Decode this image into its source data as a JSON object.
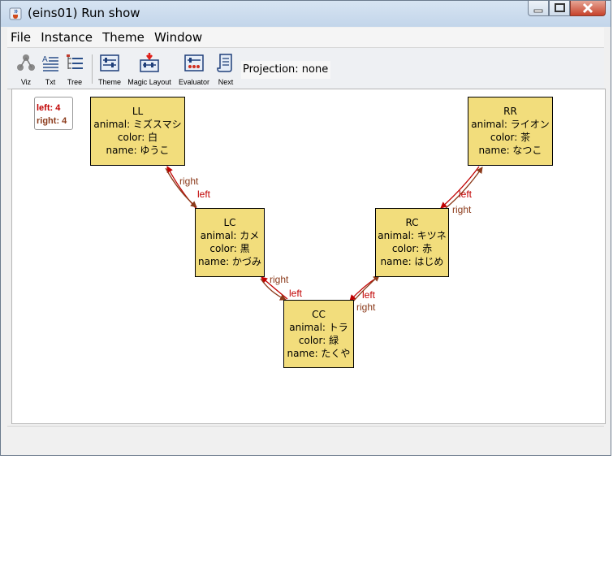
{
  "window": {
    "title": "(eins01) Run show"
  },
  "menu": [
    {
      "label": "File"
    },
    {
      "label": "Instance"
    },
    {
      "label": "Theme"
    },
    {
      "label": "Window"
    }
  ],
  "toolbar": {
    "viz": "Viz",
    "txt": "Txt",
    "tree": "Tree",
    "theme": "Theme",
    "magic_layout": "Magic Layout",
    "evaluator": "Evaluator",
    "next": "Next",
    "projection": "Projection: none"
  },
  "legend": {
    "left": "left: 4",
    "right": "right: 4"
  },
  "nodes": {
    "LL": {
      "name_label": "LL",
      "animal": "animal: ミズスマシ",
      "color": "color: 白",
      "name": "name: ゆうこ"
    },
    "LC": {
      "name_label": "LC",
      "animal": "animal: カメ",
      "color": "color: 黒",
      "name": "name: かづみ"
    },
    "CC": {
      "name_label": "CC",
      "animal": "animal: トラ",
      "color": "color: 緑",
      "name": "name: たくや"
    },
    "RC": {
      "name_label": "RC",
      "animal": "animal: キツネ",
      "color": "color: 赤",
      "name": "name: はじめ"
    },
    "RR": {
      "name_label": "RR",
      "animal": "animal: ライオン",
      "color": "color: 茶",
      "name": "name: なつこ"
    }
  },
  "edge_labels": {
    "left": "left",
    "right": "right"
  },
  "colors": {
    "left_edge": "#c00000",
    "right_edge": "#8b3a1a",
    "node_fill": "#f2dd7c"
  }
}
